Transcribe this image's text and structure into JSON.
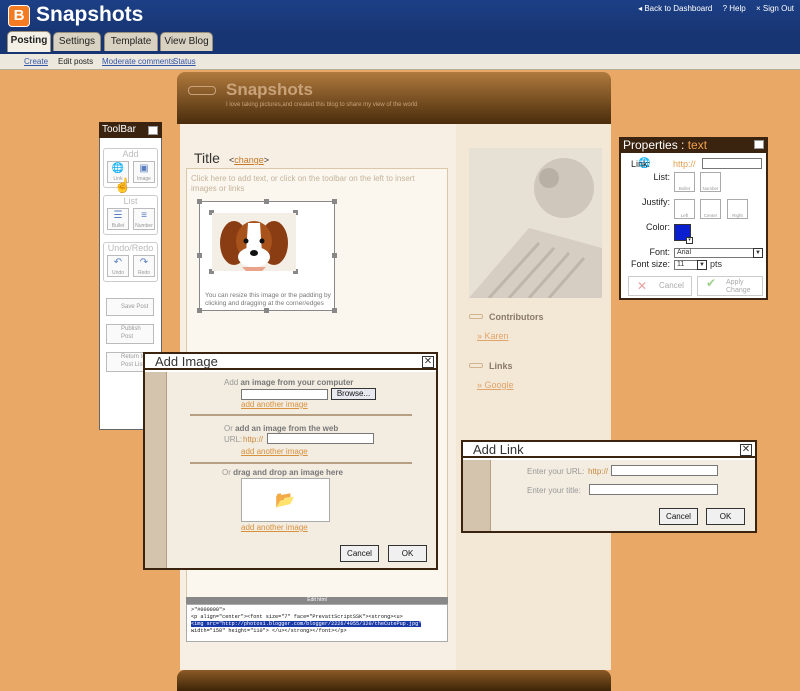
{
  "app": {
    "brand": "Snapshots",
    "logo_letter": "B",
    "top_links": [
      "Back to Dashboard",
      "? Help",
      "Sign Out"
    ]
  },
  "tabs": [
    "Posting",
    "Settings",
    "Template",
    "View Blog"
  ],
  "subnav": [
    "Create",
    "Edit posts",
    "Moderate comments",
    "Status"
  ],
  "blog": {
    "title": "Snapshots",
    "description": "I love taking pictures,and created this blog to share my view of the world"
  },
  "editor": {
    "title_label": "Title",
    "change_link": "change",
    "hint": "Click here to add text, or click on the toolbar on the left to insert images or links",
    "image_caption": "You can resize this image or the padding by clicking and dragging at the corner/edges",
    "edit_html_label": "Edit html",
    "code_lines": [
      ">\"#000000\">",
      "<p align=\"center\"><font size=\"7\" face=\"PrevattScriptSSK\"><strong><u>",
      "<img src=\"http://photos1.blogger.com/blogger/2226/4955/320/theCutePup.jpg\"",
      "width=\"150\" height=\"110\"> </u></strong></font></p>"
    ]
  },
  "sidebar": {
    "contributors_heading": "Contributors",
    "contributor": "Karen",
    "links_heading": "Links",
    "link": "Google"
  },
  "toolbar": {
    "title": "ToolBar",
    "add_label": "Add",
    "link_label": "Link",
    "image_label": "Image",
    "list_label": "List",
    "bullet_label": "Bullet",
    "number_label": "Number",
    "undoredo_label": "Undo/Redo",
    "undo_label": "Undo",
    "redo_label": "Redo",
    "save_label": "Save Post",
    "publish_label": "Publish Post",
    "return_label": "Return to Post List"
  },
  "properties": {
    "title_prefix": "Properties : ",
    "title_type": "text",
    "link_label": "Link:",
    "link_prefix": "http://",
    "list_label": "List:",
    "bullet": "Bullet",
    "number": "Number",
    "justify_label": "Justify:",
    "left": "Left",
    "center": "Center",
    "right": "Right",
    "color_label": "Color:",
    "color_value": "#0a1fd0",
    "font_label": "Font:",
    "font_value": "Arial",
    "size_label": "Font size:",
    "size_value": "11",
    "size_unit": "pts",
    "cancel": "Cancel",
    "apply": "Apply Change"
  },
  "add_image": {
    "title": "Add Image",
    "computer_prefix": "Add ",
    "computer_bold": "an image from your computer",
    "browse": "Browse...",
    "add_another": "add another image",
    "or1": "Or ",
    "web_bold": "add an image from the web",
    "url_label": "URL:",
    "url_prefix": "http://",
    "or2": "Or ",
    "drag_bold": "drag and drop an image here",
    "cancel": "Cancel",
    "ok": "OK"
  },
  "add_link": {
    "title": "Add Link",
    "url_label": "Enter your URL:",
    "url_prefix": "http://",
    "title_label": "Enter your title:",
    "cancel": "Cancel",
    "ok": "OK"
  }
}
